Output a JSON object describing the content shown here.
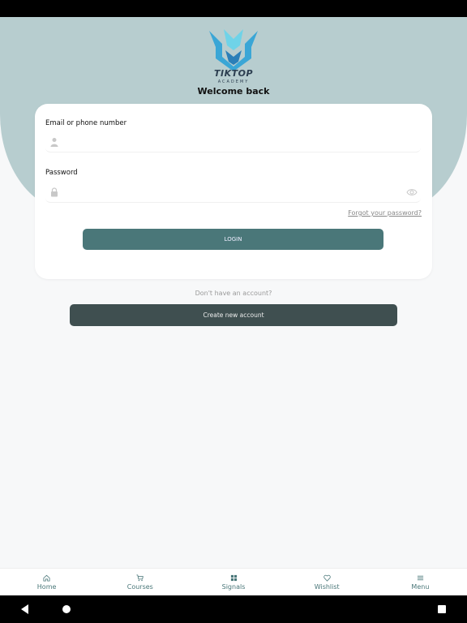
{
  "logo": {
    "brand": "TIKTOP",
    "sub": "ACADEMY"
  },
  "header": {
    "welcome": "Welcome back"
  },
  "form": {
    "email_label": "Email or phone number",
    "email_value": "",
    "password_label": "Password",
    "password_value": "",
    "forgot": "Forgot your password?",
    "login": "LOGIN"
  },
  "signup": {
    "prompt": "Don't have an account?",
    "create": "Create new account"
  },
  "nav": {
    "items": [
      {
        "label": "Home",
        "icon": "home-icon"
      },
      {
        "label": "Courses",
        "icon": "cart-icon"
      },
      {
        "label": "Signals",
        "icon": "grid-icon"
      },
      {
        "label": "Wishlist",
        "icon": "heart-icon"
      },
      {
        "label": "Menu",
        "icon": "menu-icon"
      }
    ]
  },
  "colors": {
    "accent": "#4a7779",
    "header_bg": "#b7cdcf",
    "dark_button": "#3f4f50"
  }
}
